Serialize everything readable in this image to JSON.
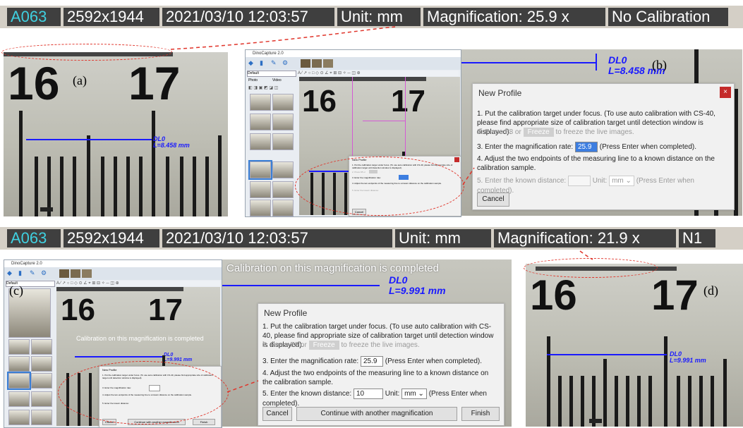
{
  "info_top": {
    "id": "A063",
    "resolution": "2592x1944",
    "datetime": "2021/03/10 12:03:57",
    "unit": "Unit: mm",
    "magnification": "Magnification:  25.9 x",
    "calibration": "No Calibration"
  },
  "info_bottom": {
    "id": "A063",
    "resolution": "2592x1944",
    "datetime": "2021/03/10 12:03:57",
    "unit": "Unit: mm",
    "magnification": "Magnification:  21.9 x",
    "calibration": "N1"
  },
  "scale": {
    "num_left": "16",
    "num_right": "17"
  },
  "panels": {
    "a": "(a)",
    "b": "(b)",
    "c": "(c)",
    "d": "(d)"
  },
  "measurement_uncal": {
    "name": "DL0",
    "length": "L=8.458 mm"
  },
  "measurement_cal": {
    "name": "DL0",
    "length": "L=9.991 mm"
  },
  "app": {
    "title": "DinoCapture 2.0",
    "profile_select": "Default",
    "tab_photo": "Photo",
    "tab_video": "Video"
  },
  "dialog": {
    "title": "New Profile",
    "close": "×",
    "step1": "1. Put the calibration target under focus. (To use auto calibration with CS-40, please find appropriate size of calibration target until detection window is displayed).",
    "step2_prefix": "2. Press F8 or",
    "step2_button": "Freeze",
    "step2_suffix": "to freeze the live images.",
    "step3_prefix": "3. Enter the magnification rate:",
    "step3_value": "25.9",
    "step3_suffix": "(Press Enter when completed).",
    "step4": "4. Adjust the two endpoints of the measuring line to a known distance on the calibration sample.",
    "step5_prefix": "5. Enter the known distance:",
    "step5_value": "10",
    "step5_unit_label": "Unit:",
    "step5_unit": "mm",
    "step5_suffix": "(Press Enter when completed).",
    "cancel": "Cancel",
    "continue": "Continue with another magnification",
    "finish": "Finish"
  },
  "calibration_banner": "Calibration on this magnification is completed"
}
